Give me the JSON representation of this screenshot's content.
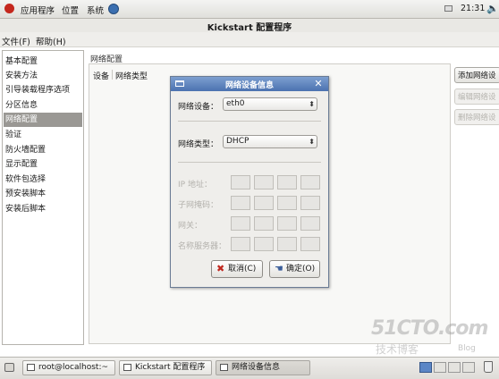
{
  "top_panel": {
    "menus": [
      "应用程序",
      "位置",
      "系统"
    ],
    "clock": "21:31"
  },
  "window": {
    "title": "Kickstart 配置程序"
  },
  "menubar": {
    "items": [
      "文件(F)",
      "帮助(H)"
    ]
  },
  "sidebar": {
    "items": [
      {
        "label": "基本配置",
        "selected": false
      },
      {
        "label": "安装方法",
        "selected": false
      },
      {
        "label": "引导装载程序选项",
        "selected": false
      },
      {
        "label": "分区信息",
        "selected": false
      },
      {
        "label": "网络配置",
        "selected": true
      },
      {
        "label": "验证",
        "selected": false
      },
      {
        "label": "防火墙配置",
        "selected": false
      },
      {
        "label": "显示配置",
        "selected": false
      },
      {
        "label": "软件包选择",
        "selected": false
      },
      {
        "label": "预安装脚本",
        "selected": false
      },
      {
        "label": "安装后脚本",
        "selected": false
      }
    ]
  },
  "main": {
    "section_title": "网络配置",
    "table_headers": [
      "设备",
      "网络类型"
    ],
    "buttons": {
      "add": "添加网络设",
      "edit": "编辑网络设",
      "delete": "删除网络设"
    }
  },
  "dialog": {
    "title": "网络设备信息",
    "device_label": "网络设备：",
    "device_value": "eth0",
    "type_label": "网络类型：",
    "type_value": "DHCP",
    "ip_label": "IP 地址：",
    "netmask_label": "子网掩码：",
    "gateway_label": "网关：",
    "nameserver_label": "名称服务器：",
    "cancel_label": "取消(C)",
    "ok_label": "确定(O)"
  },
  "taskbar": {
    "tasks": [
      "root@localhost:~",
      "Kickstart 配置程序",
      "网络设备信息"
    ]
  },
  "watermark": {
    "main": "51CTO.com",
    "sub": "技术博客",
    "blog": "Blog"
  },
  "colors": {
    "dialog_title_gradient": [
      "#7d9fd0",
      "#4b72b0"
    ],
    "selected_item": "#9a9894"
  }
}
